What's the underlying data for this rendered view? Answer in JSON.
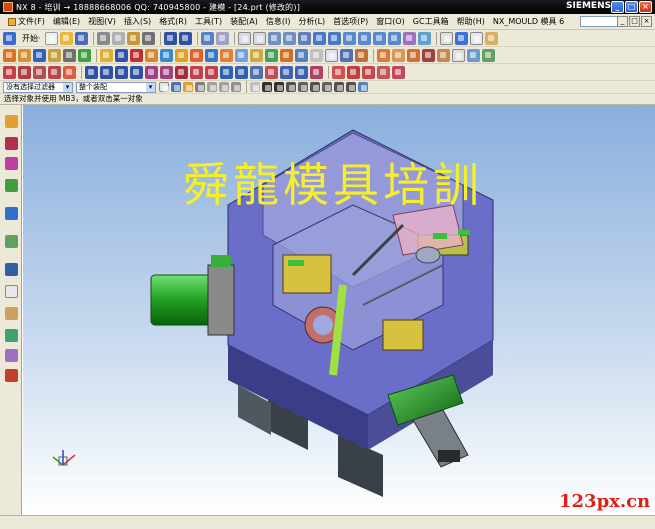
{
  "window": {
    "title": "NX 8 - 培训 → 18888668006 QQ: 740945800 - 建模 - [24.prt (修改的)]",
    "brand": "SIEMENS",
    "buttons": [
      "_",
      "□",
      "×"
    ]
  },
  "menubar": {
    "items": [
      "文件(F)",
      "编辑(E)",
      "视图(V)",
      "插入(S)",
      "格式(R)",
      "工具(T)",
      "装配(A)",
      "信息(I)",
      "分析(L)",
      "首选项(P)",
      "窗口(O)",
      "GC工具箱",
      "帮助(H)",
      "NX_MOULD 模具 6"
    ],
    "mdi_buttons": [
      "_",
      "□",
      "×"
    ]
  },
  "toolbar": {
    "start_label": "开始·",
    "filter_combo": "没有选择过滤器",
    "scope_combo": "整个装配"
  },
  "status": {
    "prompt": "选择对象并使用 MB3，或者双击某一对象"
  },
  "viewport": {
    "watermark": "舜龍模具培訓",
    "site_mark": "123px.cn",
    "background_top": "#8aaedd",
    "background_bottom": "#ffffff",
    "model_color": "#6a6ec8",
    "cylinder_color": "#2aa82a",
    "watermark_color": "#f5ef2a",
    "site_mark_color": "#e02018"
  }
}
